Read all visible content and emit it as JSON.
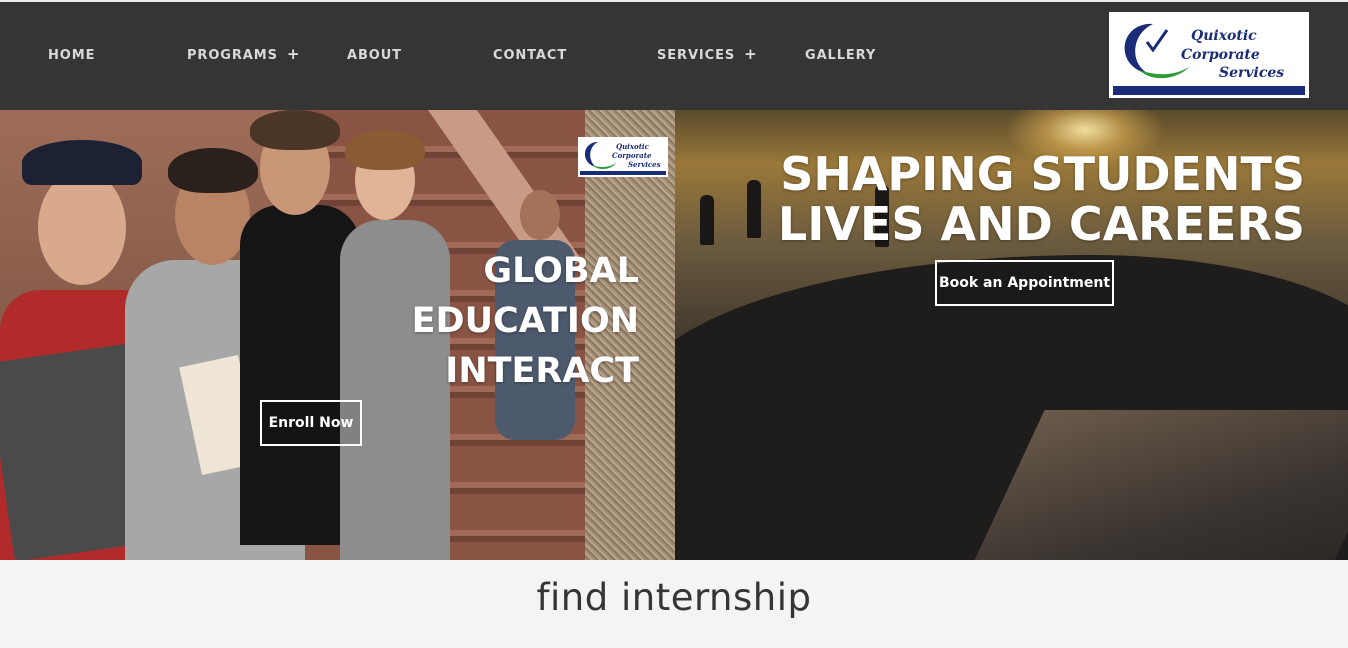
{
  "nav": {
    "items": [
      {
        "label": "HOME",
        "has_submenu": false
      },
      {
        "label": "PROGRAMS",
        "has_submenu": true
      },
      {
        "label": "ABOUT",
        "has_submenu": false
      },
      {
        "label": "CONTACT",
        "has_submenu": false
      },
      {
        "label": "SERVICES",
        "has_submenu": true
      },
      {
        "label": "GALLERY",
        "has_submenu": false
      }
    ],
    "submenu_glyph": "+"
  },
  "logo": {
    "line1": "Quixotic",
    "line2": "Corporate",
    "line3": "Services"
  },
  "hero": {
    "left": {
      "heading_line1": "GLOBAL",
      "heading_line2": "EDUCATION",
      "heading_line3": "INTERACT",
      "button_label": "Enroll Now"
    },
    "right": {
      "heading_line1": "SHAPING STUDENTS",
      "heading_line2": "LIVES AND CAREERS",
      "button_label": "Book an Appointment"
    }
  },
  "footer": {
    "text": "find internship"
  },
  "colors": {
    "nav_bg": "#353535",
    "nav_text": "#d9d9d9",
    "logo_blue": "#1a2b77",
    "logo_green": "#2e9b3a",
    "page_bg": "#f4f4f4",
    "footer_text": "#353535"
  }
}
